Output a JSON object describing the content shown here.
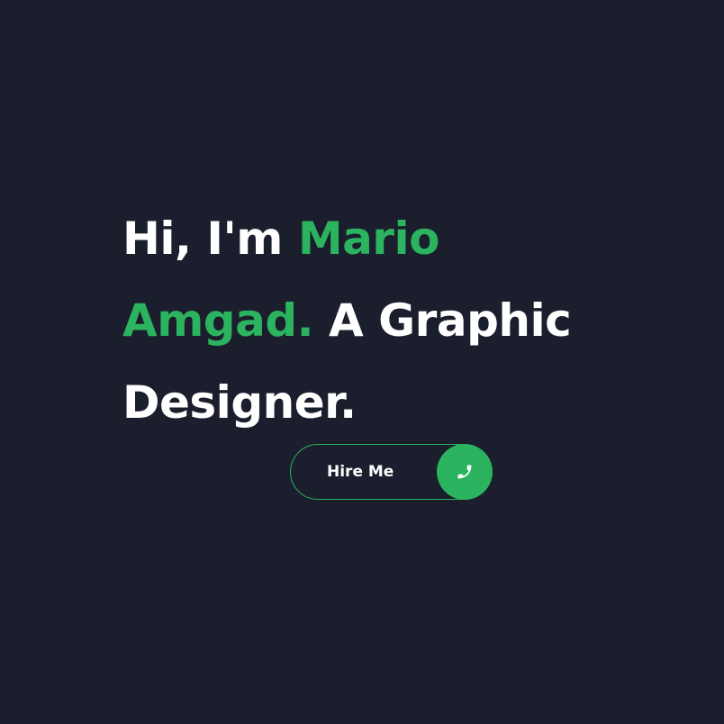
{
  "hero": {
    "line1_prefix": "Hi, I'm ",
    "name_first": "Mario",
    "name_last": "Amgad.",
    "line2_rest": " A Graphic",
    "line3": "Designer."
  },
  "cta": {
    "label": "Hire Me",
    "icon": "phone-icon"
  },
  "colors": {
    "background": "#1b1e2c",
    "accent": "#2bb35f",
    "text": "#ffffff"
  }
}
